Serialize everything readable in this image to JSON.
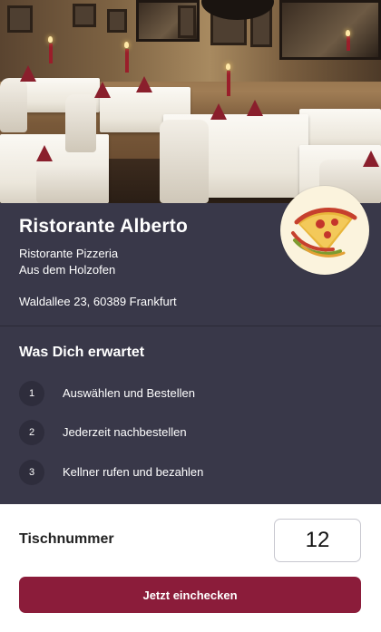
{
  "restaurant": {
    "name": "Ristorante Alberto",
    "subtitle_line1": "Ristorante Pizzeria",
    "subtitle_line2": "Aus dem Holzofen",
    "address": "Waldallee 23, 60389 Frankfurt",
    "logo_icon": "pizza-slice-logo"
  },
  "expect": {
    "title": "Was Dich erwartet",
    "steps": [
      {
        "number": "1",
        "label": "Auswählen und Bestellen"
      },
      {
        "number": "2",
        "label": "Jederzeit nachbestellen"
      },
      {
        "number": "3",
        "label": "Kellner rufen und bezahlen"
      }
    ]
  },
  "checkin": {
    "table_label": "Tischnummer",
    "table_value": "12",
    "button_label": "Jetzt einchecken"
  },
  "colors": {
    "panel": "#393849",
    "step_badge": "#2e2d3c",
    "cta": "#8b1c3a"
  }
}
